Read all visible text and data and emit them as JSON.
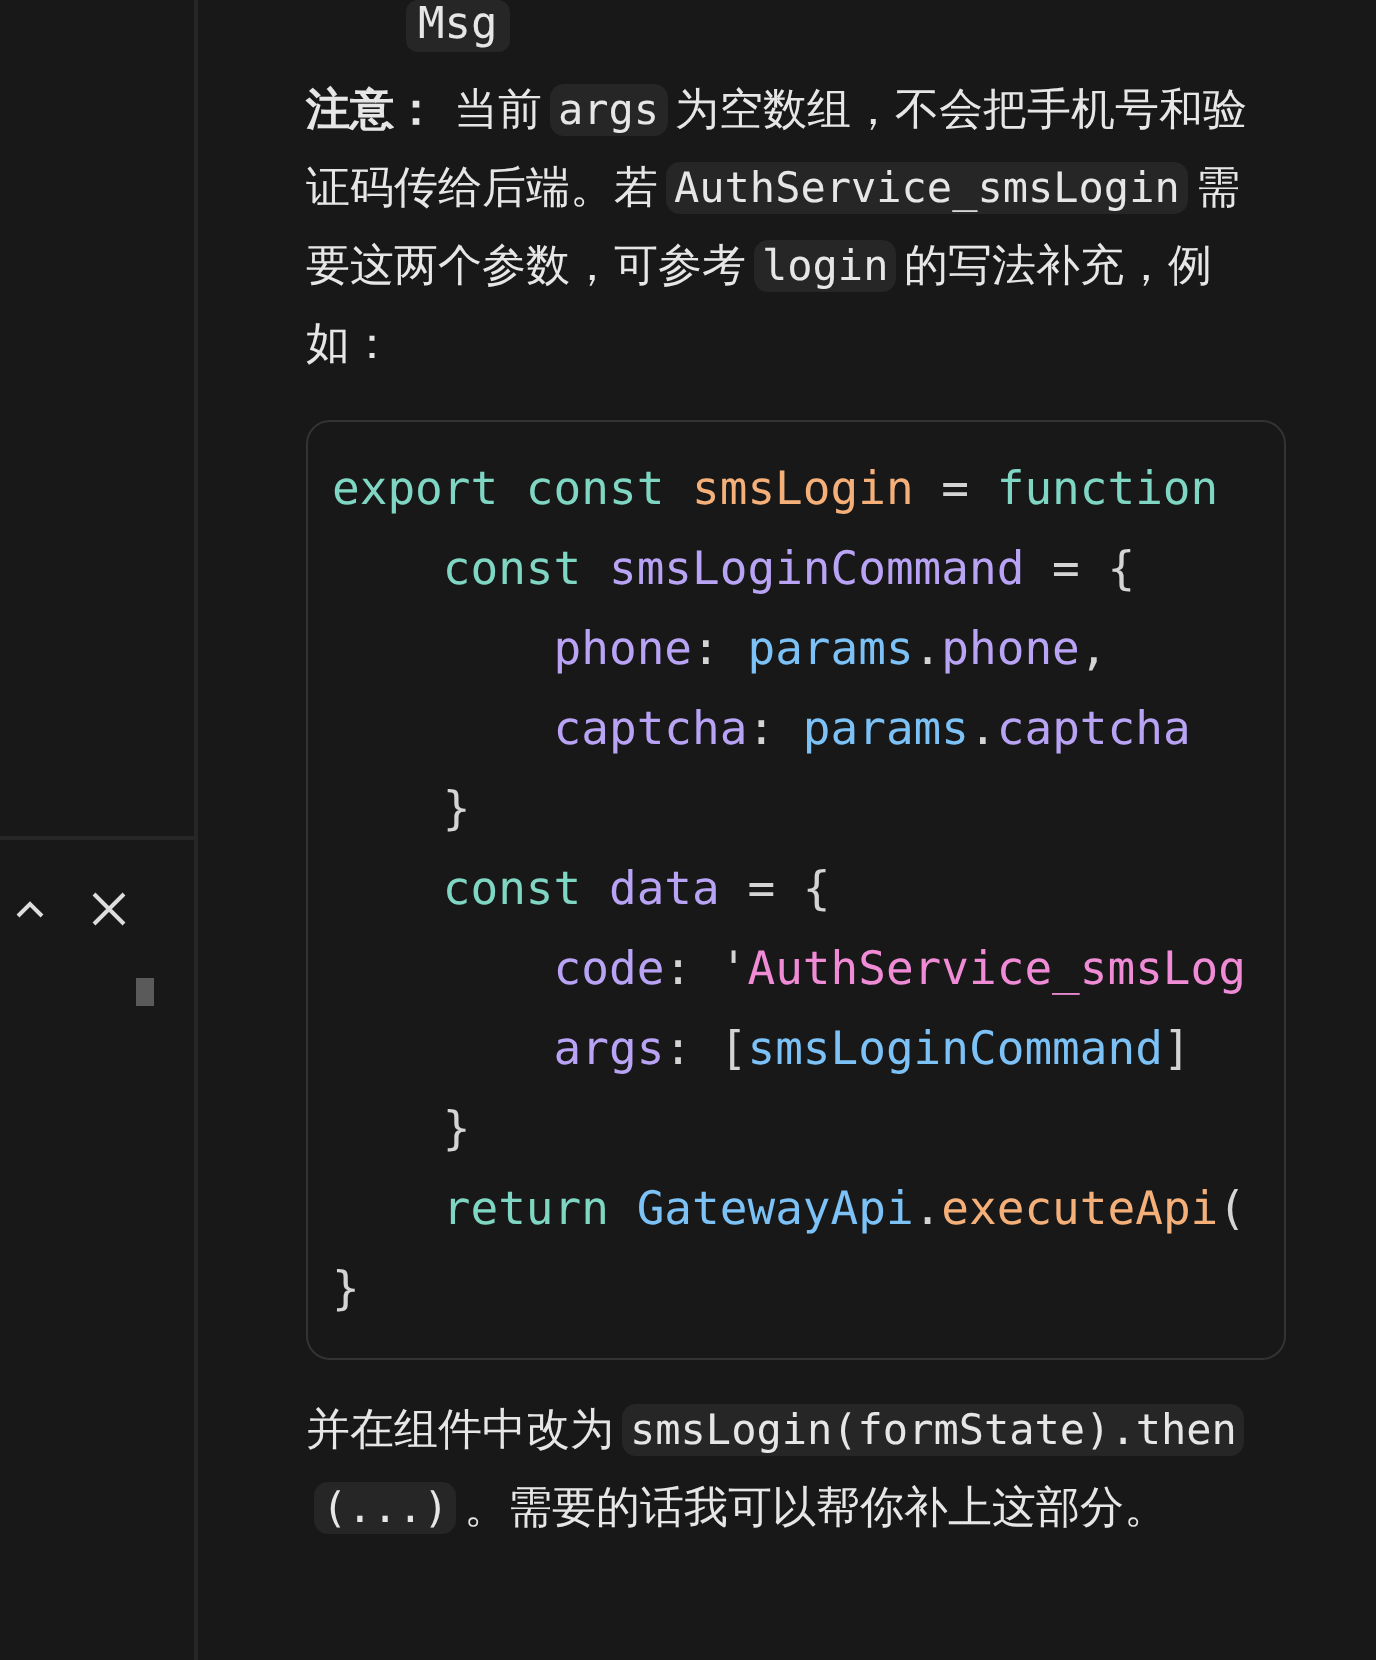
{
  "list_item_code": "Msg",
  "note": {
    "segments": [
      {
        "text": "注意：",
        "kind": "bold"
      },
      {
        "text": "当前",
        "kind": "text"
      },
      {
        "text": "args",
        "kind": "code"
      },
      {
        "text": "为空数组，不会把手机号和验证码传给后端。若",
        "kind": "text"
      },
      {
        "text": "AuthService_smsLogin",
        "kind": "code"
      },
      {
        "text": "需要这两个参数，可参考",
        "kind": "text"
      },
      {
        "text": "login",
        "kind": "code"
      },
      {
        "text": "的写法补充，例如：",
        "kind": "text"
      }
    ]
  },
  "code_block": {
    "lines": [
      {
        "tokens": [
          {
            "text": "export const ",
            "kind": "keyword"
          },
          {
            "text": "smsLogin",
            "kind": "function"
          },
          {
            "text": " = ",
            "kind": "plain"
          },
          {
            "text": "function",
            "kind": "keyword"
          }
        ]
      },
      {
        "tokens": [
          {
            "text": "    const ",
            "kind": "keyword"
          },
          {
            "text": "smsLoginCommand",
            "kind": "variable"
          },
          {
            "text": " = {",
            "kind": "plain"
          }
        ]
      },
      {
        "tokens": [
          {
            "text": "        phone",
            "kind": "variable"
          },
          {
            "text": ": ",
            "kind": "plain"
          },
          {
            "text": "params",
            "kind": "object"
          },
          {
            "text": ".",
            "kind": "plain"
          },
          {
            "text": "phone",
            "kind": "variable"
          },
          {
            "text": ",",
            "kind": "plain"
          }
        ]
      },
      {
        "tokens": [
          {
            "text": "        captcha",
            "kind": "variable"
          },
          {
            "text": ": ",
            "kind": "plain"
          },
          {
            "text": "params",
            "kind": "object"
          },
          {
            "text": ".",
            "kind": "plain"
          },
          {
            "text": "captcha",
            "kind": "variable"
          }
        ]
      },
      {
        "tokens": [
          {
            "text": "    }",
            "kind": "plain"
          }
        ]
      },
      {
        "tokens": [
          {
            "text": "    const ",
            "kind": "keyword"
          },
          {
            "text": "data",
            "kind": "variable"
          },
          {
            "text": " = {",
            "kind": "plain"
          }
        ]
      },
      {
        "tokens": [
          {
            "text": "        code",
            "kind": "variable"
          },
          {
            "text": ": '",
            "kind": "plain"
          },
          {
            "text": "AuthService_smsLog",
            "kind": "string"
          }
        ]
      },
      {
        "tokens": [
          {
            "text": "        args",
            "kind": "variable"
          },
          {
            "text": ": [",
            "kind": "plain"
          },
          {
            "text": "smsLoginCommand",
            "kind": "object"
          },
          {
            "text": "]",
            "kind": "plain"
          }
        ]
      },
      {
        "tokens": [
          {
            "text": "    }",
            "kind": "plain"
          }
        ]
      },
      {
        "tokens": [
          {
            "text": "    return ",
            "kind": "keyword"
          },
          {
            "text": "GatewayApi",
            "kind": "object"
          },
          {
            "text": ".",
            "kind": "plain"
          },
          {
            "text": "executeApi",
            "kind": "function"
          },
          {
            "text": "(",
            "kind": "plain"
          }
        ]
      },
      {
        "tokens": [
          {
            "text": "}",
            "kind": "plain"
          }
        ]
      }
    ]
  },
  "follow_up": {
    "segments": [
      {
        "text": "并在组件中改为",
        "kind": "text"
      },
      {
        "text": "smsLogin(formState).then(...)",
        "kind": "code"
      },
      {
        "text": "。需要的话我可以帮你补上这部分。",
        "kind": "text"
      }
    ]
  }
}
